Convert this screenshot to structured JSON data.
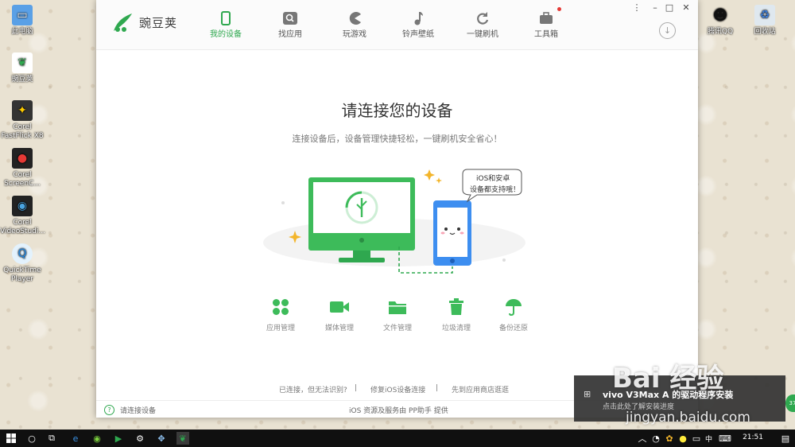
{
  "desktop": {
    "left_icons": [
      {
        "label": "此电脑",
        "icon": "computer-icon",
        "color": "#5aa0e6"
      },
      {
        "label": "豌豆荚",
        "icon": "wandoujia-icon",
        "color": "#2fa84f"
      },
      {
        "label": "Corel FastFlick X8",
        "icon": "star-icon",
        "color": "#d9a200"
      },
      {
        "label": "Corel ScreenC...",
        "icon": "record-icon",
        "color": "#c62828"
      },
      {
        "label": "Corel VideoStudi...",
        "icon": "video-icon",
        "color": "#1565c0"
      },
      {
        "label": "QuickTime Player",
        "icon": "quicktime-icon",
        "color": "#4aa3df"
      }
    ],
    "right_icons": [
      {
        "label": "腾讯QQ",
        "icon": "qq-icon"
      },
      {
        "label": "回收站",
        "icon": "recycle-bin-icon"
      }
    ]
  },
  "app": {
    "name": "豌豆荚",
    "accent": "#2fa84f",
    "nav": [
      {
        "label": "我的设备",
        "icon": "phone-icon",
        "active": true
      },
      {
        "label": "找应用",
        "icon": "search-icon",
        "active": false
      },
      {
        "label": "玩游戏",
        "icon": "pacman-icon",
        "active": false
      },
      {
        "label": "铃声壁纸",
        "icon": "music-note-icon",
        "active": false
      },
      {
        "label": "一键刷机",
        "icon": "refresh-icon",
        "active": false
      },
      {
        "label": "工具箱",
        "icon": "toolbox-icon",
        "active": false
      }
    ],
    "window_controls": [
      "⋮",
      "–",
      "□",
      "✕"
    ],
    "download_symbol": "↓",
    "main": {
      "title": "请连接您的设备",
      "subtitle": "连接设备后，设备管理快捷轻松，一键刷机安全省心！",
      "bubble_line1": "iOS和安卓",
      "bubble_line2": "设备都支持哦！"
    },
    "features": [
      {
        "label": "应用管理",
        "icon": "apps-icon"
      },
      {
        "label": "媒体管理",
        "icon": "camera-icon"
      },
      {
        "label": "文件管理",
        "icon": "folder-icon"
      },
      {
        "label": "垃圾清理",
        "icon": "trash-icon"
      },
      {
        "label": "备份还原",
        "icon": "umbrella-icon"
      }
    ],
    "links": [
      "已连接，但无法识别?",
      "修复iOS设备连接",
      "先到应用商店逛逛"
    ],
    "separator": "|",
    "status": {
      "help_symbol": "?",
      "text": "请连接设备",
      "provider": "iOS 资源及服务由 PP助手 提供"
    }
  },
  "notification": {
    "title": "vivo V3Max A 的驱动程序安装",
    "body": "点击此处了解安装进度"
  },
  "watermark": {
    "logo": "Bai 经验",
    "url": "jingyan.baidu.com"
  },
  "side_badge": "37",
  "taskbar": {
    "time": "21:51",
    "lang": "中"
  }
}
